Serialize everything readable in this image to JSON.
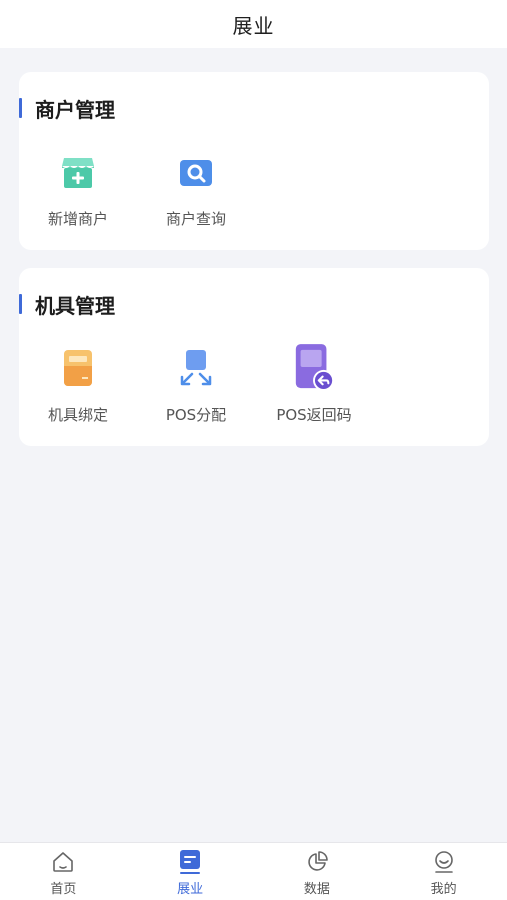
{
  "header": {
    "title": "展业"
  },
  "sections": [
    {
      "title": "商户管理",
      "items": [
        {
          "label": "新增商户",
          "icon": "store-add-icon"
        },
        {
          "label": "商户查询",
          "icon": "search-icon"
        }
      ]
    },
    {
      "title": "机具管理",
      "items": [
        {
          "label": "机具绑定",
          "icon": "device-bind-icon"
        },
        {
          "label": "POS分配",
          "icon": "pos-distribute-icon"
        },
        {
          "label": "POS返回码",
          "icon": "pos-return-icon"
        }
      ]
    }
  ],
  "tabbar": {
    "active": "展业",
    "tabs": [
      {
        "label": "首页",
        "icon": "home-icon"
      },
      {
        "label": "展业",
        "icon": "business-icon"
      },
      {
        "label": "数据",
        "icon": "chart-icon"
      },
      {
        "label": "我的",
        "icon": "profile-icon"
      }
    ]
  },
  "colors": {
    "accent": "#3f6ad8",
    "background": "#f3f4f8",
    "teal": "#4cc9a8",
    "orange": "#f4a04a",
    "purple": "#7b5cd6"
  }
}
